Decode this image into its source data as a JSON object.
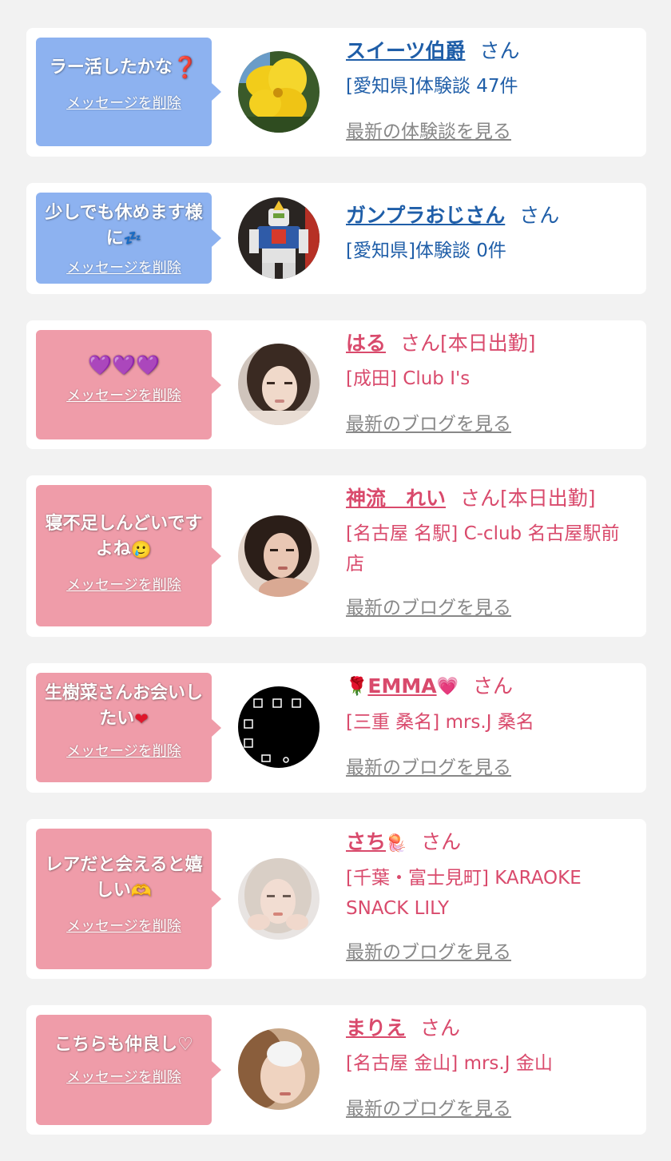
{
  "delete_label": "メッセージを削除",
  "san_suffix": "さん",
  "colors": {
    "customer_bubble": "#8db2f0",
    "girl_bubble": "#ef9ca9",
    "customer_text": "#1f5ea8",
    "girl_text": "#d94a6c",
    "link_gray": "#888888"
  },
  "cards": [
    {
      "type": "customer",
      "message": "ラー活したかな",
      "message_icon": "question-mark",
      "name": "スイーツ伯爵",
      "suffix": "さん",
      "detail": "[愛知県]体験談 47件",
      "link": "最新の体験談を見る"
    },
    {
      "type": "customer",
      "message": "少しでも休めます様に",
      "message_icon": "sleeping-zzz",
      "name": "ガンプラおじさん",
      "suffix": "さん",
      "detail": "[愛知県]体験談 0件"
    },
    {
      "type": "girl",
      "message": "💜💜💜",
      "name": "はる",
      "suffix": "さん[本日出勤]",
      "detail": "[成田] Club I's",
      "link": "最新のブログを見る"
    },
    {
      "type": "girl",
      "message": "寝不足しんどいですよね",
      "message_icon": "smiling-tear-face",
      "name": "神流　れい",
      "suffix": "さん[本日出勤]",
      "detail": "[名古屋 名駅] C-club 名古屋駅前店",
      "link": "最新のブログを見る"
    },
    {
      "type": "girl",
      "message": "生樹菜さんお会いしたい",
      "message_icon": "red-heart",
      "name": "EMMA",
      "name_prefix_icon": "rose",
      "name_suffix_icon": "pink-heart",
      "suffix": "さん",
      "detail": "[三重 桑名] mrs.J 桑名",
      "link": "最新のブログを見る"
    },
    {
      "type": "girl",
      "message": "レアだと会えると嬉しい",
      "message_icon": "heart-hands",
      "name": "さち",
      "name_suffix_icon": "jellyfish",
      "suffix": "さん",
      "detail": "[千葉・富士見町] KARAOKE SNACK LILY",
      "link": "最新のブログを見る"
    },
    {
      "type": "girl",
      "message": "こちらも仲良し♡",
      "name": "まりえ",
      "suffix": "さん",
      "detail": "[名古屋 金山] mrs.J 金山",
      "link": "最新のブログを見る"
    }
  ]
}
